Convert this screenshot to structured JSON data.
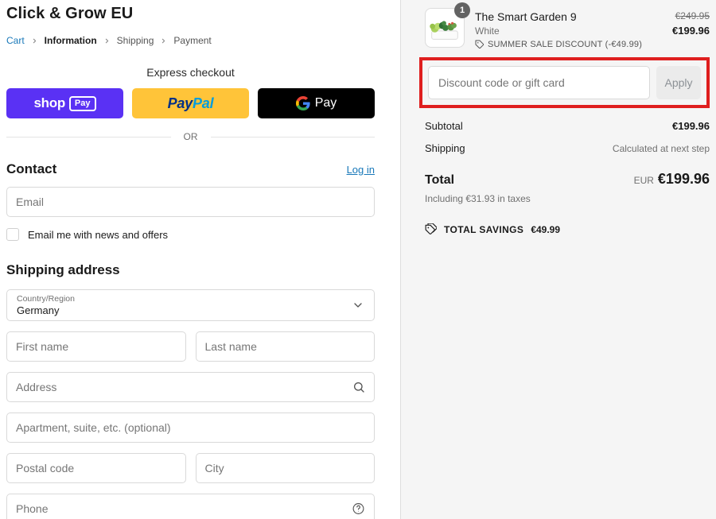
{
  "header": {
    "store_name": "Click & Grow EU"
  },
  "breadcrumb": {
    "items": [
      "Cart",
      "Information",
      "Shipping",
      "Payment"
    ]
  },
  "express": {
    "title": "Express checkout",
    "divider": "OR",
    "shop_pay": {
      "word": "shop",
      "badge": "Pay"
    },
    "paypal": {
      "pay": "Pay",
      "pal": "Pal"
    },
    "google_pay": {
      "word": "Pay"
    }
  },
  "contact": {
    "heading": "Contact",
    "login_label": "Log in",
    "email_placeholder": "Email",
    "newsletter_label": "Email me with news and offers"
  },
  "shipping": {
    "heading": "Shipping address",
    "country_label": "Country/Region",
    "country_value": "Germany",
    "first_name_placeholder": "First name",
    "last_name_placeholder": "Last name",
    "address_placeholder": "Address",
    "apartment_placeholder": "Apartment, suite, etc. (optional)",
    "postal_placeholder": "Postal code",
    "city_placeholder": "City",
    "phone_placeholder": "Phone"
  },
  "summary": {
    "item": {
      "quantity": "1",
      "name": "The Smart Garden 9",
      "variant": "White",
      "discount_label": "SUMMER SALE DISCOUNT (-€49.99)",
      "original_price": "€249.95",
      "price": "€199.96"
    },
    "discount": {
      "placeholder": "Discount code or gift card",
      "apply_label": "Apply"
    },
    "totals": {
      "subtotal_label": "Subtotal",
      "subtotal_value": "€199.96",
      "shipping_label": "Shipping",
      "shipping_value": "Calculated at next step",
      "total_label": "Total",
      "currency": "EUR",
      "total_value": "€199.96",
      "taxes_note": "Including €31.93 in taxes",
      "savings_label": "TOTAL SAVINGS",
      "savings_value": "€49.99"
    }
  },
  "icons": [
    "chevron-right-icon",
    "google-g-icon",
    "chevron-down-icon",
    "search-icon",
    "help-icon",
    "tag-icon",
    "tags-icon",
    "quantity-badge"
  ],
  "colors": {
    "shop_pay_purple": "#5a31f4",
    "paypal_yellow": "#ffc439",
    "google_pay_black": "#000000",
    "link_blue": "#1878b9",
    "annotation_red": "#df1f1f",
    "sidebar_bg": "#f5f5f5"
  }
}
